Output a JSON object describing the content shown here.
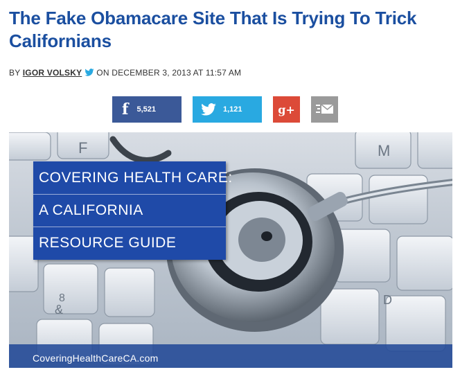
{
  "article": {
    "headline": "The Fake Obamacare Site That Is Trying To Trick Californians",
    "byline": {
      "prefix": "BY",
      "author": "IGOR VOLSKY",
      "date": "ON DECEMBER 3, 2013 AT 11:57 AM"
    }
  },
  "share": {
    "facebook": {
      "glyph": "f",
      "count": "5,521",
      "icon": "facebook-icon",
      "color": "#3b5998"
    },
    "twitter": {
      "count": "1,121",
      "icon": "twitter-bird-icon",
      "color": "#29a9e1"
    },
    "googleplus": {
      "glyph": "g+",
      "icon": "google-plus-icon",
      "color": "#dc4a38"
    },
    "email": {
      "icon": "email-envelope-icon",
      "color": "#9a9a9a"
    }
  },
  "hero": {
    "guide_lines": [
      "COVERING HEALTH CARE:",
      "A CALIFORNIA",
      "RESOURCE GUIDE"
    ],
    "url": "CoveringHealthCareCA.com",
    "box_color": "#1f4aa8"
  },
  "colors": {
    "headline": "#1b4fa0"
  }
}
